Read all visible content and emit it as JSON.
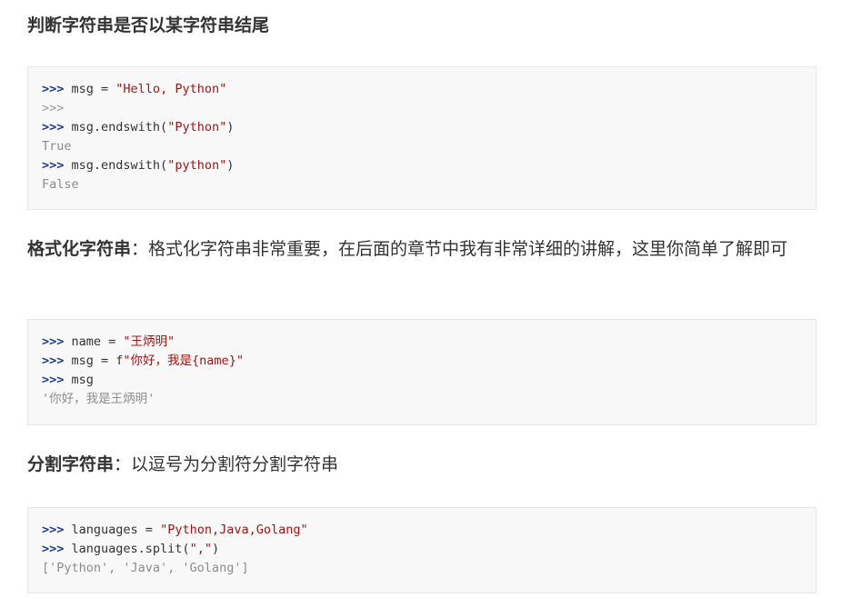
{
  "heading": "判断字符串是否以某字符串结尾",
  "block1": {
    "l1_prompt": ">>>",
    "l1_code": " msg = ",
    "l1_str": "\"Hello, Python\"",
    "l2_prompt": ">>>",
    "l3_prompt": ">>>",
    "l3_code_a": " msg.endswith(",
    "l3_str": "\"Python\"",
    "l3_code_b": ")",
    "l4_out": "True",
    "l5_prompt": ">>>",
    "l5_code_a": " msg.endswith(",
    "l5_str": "\"python\"",
    "l5_code_b": ")",
    "l6_out": "False"
  },
  "para1": {
    "term": "格式化字符串",
    "text": "：格式化字符串非常重要，在后面的章节中我有非常详细的讲解，这里你简单了解即可"
  },
  "block2": {
    "l1_prompt": ">>>",
    "l1_code": " name = ",
    "l1_str": "\"王炳明\"",
    "l2_prompt": ">>>",
    "l2_code": " msg = f",
    "l2_str": "\"你好，我是{name}\"",
    "l3_prompt": ">>>",
    "l3_code": " msg",
    "l4_out": "'你好，我是王炳明'"
  },
  "para2": {
    "term": "分割字符串",
    "text": "：以逗号为分割符分割字符串"
  },
  "block3": {
    "l1_prompt": ">>>",
    "l1_code": " languages = ",
    "l1_str": "\"Python,Java,Golang\"",
    "l2_prompt": ">>>",
    "l2_code_a": " languages.split(",
    "l2_str": "\",\"",
    "l2_code_b": ")",
    "l3_out": "['Python', 'Java', 'Golang']"
  }
}
